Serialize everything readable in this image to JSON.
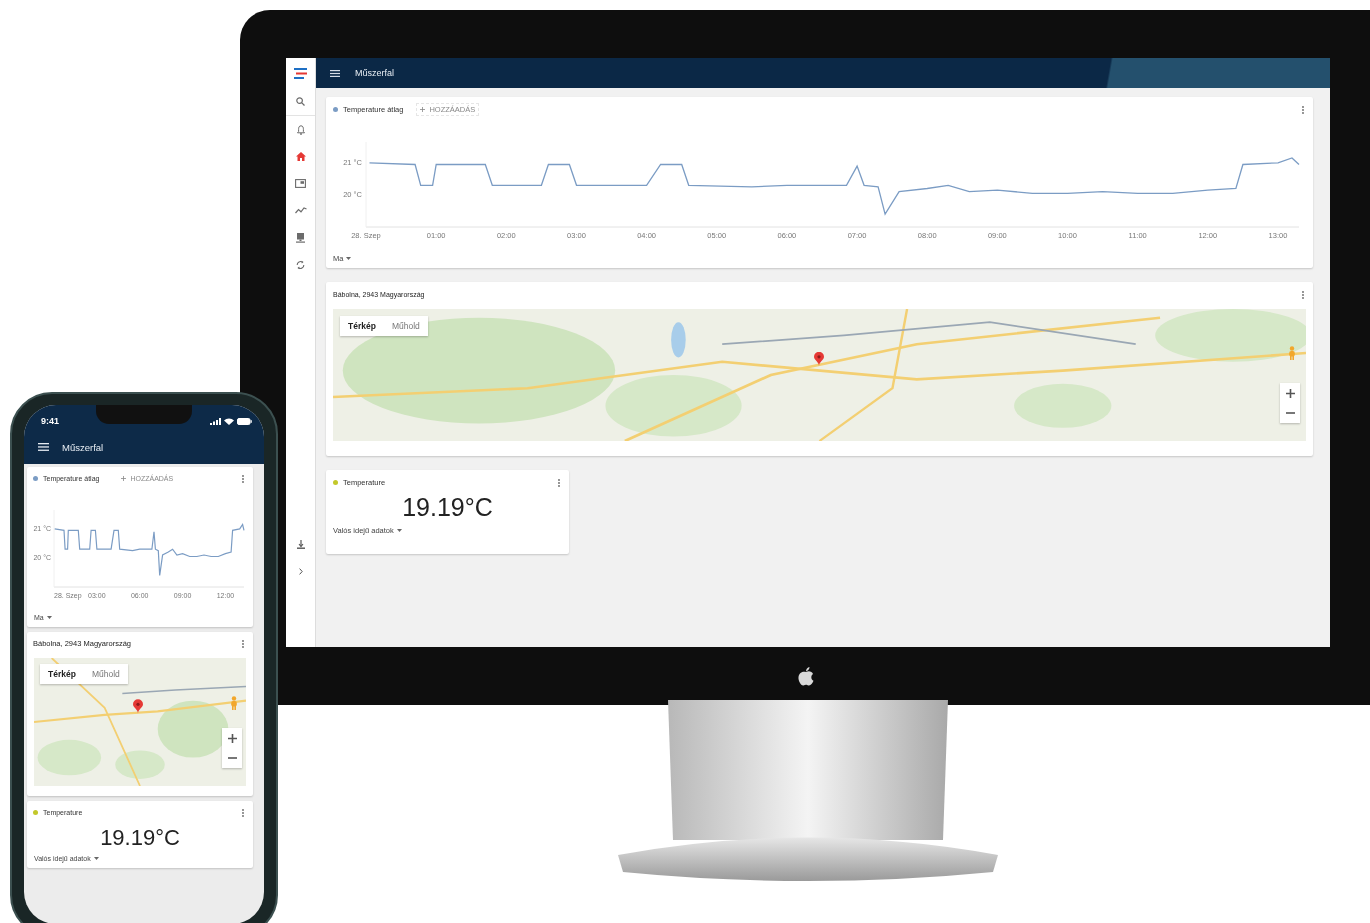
{
  "desktop": {
    "sidebar": {
      "items": [
        {
          "kind": "search",
          "selected": false
        },
        {
          "kind": "bell",
          "selected": false
        },
        {
          "kind": "home",
          "selected": true
        },
        {
          "kind": "widget",
          "selected": false
        },
        {
          "kind": "trend",
          "selected": false
        },
        {
          "kind": "device",
          "selected": false
        },
        {
          "kind": "sync",
          "selected": false
        }
      ],
      "bottom_items": [
        {
          "kind": "download"
        },
        {
          "kind": "expand"
        }
      ]
    },
    "top_bar": {
      "title": "Műszerfal"
    },
    "chart_card": {
      "add_label": "HOZZÁADÁS",
      "range": "Ma",
      "date_label": "28. Szep",
      "chart_data": {
        "type": "line",
        "x": [
          0.05,
          0.7,
          0.78,
          0.95,
          1.0,
          1.7,
          1.8,
          2.5,
          2.6,
          2.9,
          3.0,
          4.0,
          4.2,
          4.5,
          4.6,
          5.5,
          6.0,
          6.5,
          6.85,
          7.0,
          7.1,
          7.3,
          7.4,
          7.6,
          8.0,
          8.3,
          8.6,
          9.0,
          9.5,
          10.0,
          10.5,
          11.0,
          11.5,
          12.0,
          12.4,
          12.5,
          13.0,
          13.2,
          13.3
        ],
        "series": [
          {
            "name": "Temperature átlag",
            "color": "#7b9cc4",
            "values": [
              21.0,
              20.95,
              20.3,
              20.3,
              20.95,
              20.95,
              20.3,
              20.3,
              20.95,
              20.95,
              20.3,
              20.3,
              20.95,
              20.95,
              20.3,
              20.25,
              20.3,
              20.3,
              20.3,
              20.9,
              20.3,
              20.25,
              19.4,
              20.1,
              20.2,
              20.3,
              20.1,
              20.15,
              20.05,
              20.05,
              20.1,
              20.05,
              20.05,
              20.15,
              20.2,
              20.95,
              21.0,
              21.15,
              20.95
            ]
          }
        ],
        "xlim": [
          0,
          13.3
        ],
        "ylim": [
          19,
          21.65
        ],
        "xticks": [
          {
            "value": 1,
            "label": "01:00"
          },
          {
            "value": 2,
            "label": "02:00"
          },
          {
            "value": 3,
            "label": "03:00"
          },
          {
            "value": 4,
            "label": "04:00"
          },
          {
            "value": 5,
            "label": "05:00"
          },
          {
            "value": 6,
            "label": "06:00"
          },
          {
            "value": 7,
            "label": "07:00"
          },
          {
            "value": 8,
            "label": "08:00"
          },
          {
            "value": 9,
            "label": "09:00"
          },
          {
            "value": 10,
            "label": "10:00"
          },
          {
            "value": 11,
            "label": "11:00"
          },
          {
            "value": 12,
            "label": "12:00"
          },
          {
            "value": 13,
            "label": "13:00"
          }
        ],
        "yticks": [
          {
            "value": 20,
            "label": "20 °C"
          },
          {
            "value": 21,
            "label": "21 °C"
          }
        ]
      }
    },
    "map_card": {
      "title": "Bábolna, 2943 Magyarország",
      "map_types": [
        {
          "label": "Térkép",
          "selected": true
        },
        {
          "label": "Műhold",
          "selected": false
        }
      ]
    },
    "temperature_card": {
      "label": "Temperature",
      "color": "#c3c82a",
      "value": "19.19°C",
      "mode": "Valós idejű adatok"
    }
  },
  "phone": {
    "status_bar": {
      "time": "9:41"
    },
    "top_bar": {
      "title": "Műszerfal"
    },
    "chart_card": {
      "add_label": "HOZZÁADÁS",
      "range": "Ma",
      "date_label": "28. Szep",
      "chart_data": {
        "type": "line",
        "x": [
          0.05,
          0.7,
          0.78,
          0.95,
          1.0,
          1.7,
          1.8,
          2.5,
          2.6,
          2.9,
          3.0,
          4.0,
          4.2,
          4.5,
          4.6,
          5.5,
          6.0,
          6.5,
          6.85,
          7.0,
          7.1,
          7.3,
          7.4,
          7.6,
          8.0,
          8.3,
          8.6,
          9.0,
          9.5,
          10.0,
          10.5,
          11.0,
          11.5,
          12.0,
          12.4,
          12.5,
          13.0,
          13.2,
          13.3
        ],
        "series": [
          {
            "name": "Temperature átlag",
            "color": "#7b9cc4",
            "values": [
              21.0,
              20.95,
              20.3,
              20.3,
              20.95,
              20.95,
              20.3,
              20.3,
              20.95,
              20.95,
              20.3,
              20.3,
              20.95,
              20.95,
              20.3,
              20.25,
              20.3,
              20.3,
              20.3,
              20.9,
              20.3,
              20.25,
              19.4,
              20.1,
              20.2,
              20.3,
              20.1,
              20.15,
              20.05,
              20.05,
              20.1,
              20.05,
              20.05,
              20.15,
              20.2,
              20.95,
              21.0,
              21.15,
              20.95
            ]
          }
        ],
        "xlim": [
          0,
          13.3
        ],
        "ylim": [
          19,
          21.65
        ],
        "xticks": [
          {
            "value": 3,
            "label": "03:00"
          },
          {
            "value": 6,
            "label": "06:00"
          },
          {
            "value": 9,
            "label": "09:00"
          },
          {
            "value": 12,
            "label": "12:00"
          }
        ],
        "yticks": [
          {
            "value": 20,
            "label": "20 °C"
          },
          {
            "value": 21,
            "label": "21 °C"
          }
        ]
      }
    },
    "map_card": {
      "title": "Bábolna, 2943 Magyarország",
      "map_types": [
        {
          "label": "Térkép",
          "selected": true
        },
        {
          "label": "Műhold",
          "selected": false
        }
      ]
    },
    "temperature_card": {
      "label": "Temperature",
      "color": "#c3c82a",
      "value": "19.19°C",
      "mode": "Valós idejű adatok"
    }
  }
}
